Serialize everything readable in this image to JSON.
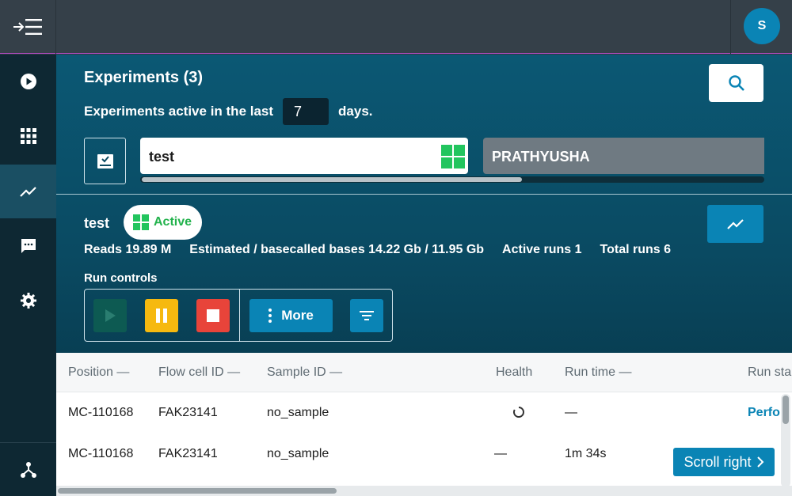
{
  "user": {
    "initial": "S"
  },
  "sidebar": {
    "items": [
      {
        "icon": "play-circle-icon",
        "active": false
      },
      {
        "icon": "apps-grid-icon",
        "active": false
      },
      {
        "icon": "trending-chart-icon",
        "active": true
      },
      {
        "icon": "message-icon",
        "active": false
      },
      {
        "icon": "gear-icon",
        "active": false
      }
    ],
    "bottom_icon": "network-icon"
  },
  "experiments": {
    "title": "Experiments (3)",
    "active_prefix": "Experiments active in the last",
    "days_value": "7",
    "active_suffix": "days.",
    "cards": [
      {
        "name": "test",
        "status_color": "#22c55e"
      },
      {
        "name": "PRATHYUSHA"
      }
    ]
  },
  "selected": {
    "name": "test",
    "status": "Active",
    "stats": {
      "reads": "Reads 19.89 M",
      "bases": "Estimated / basecalled bases 14.22 Gb / 11.95 Gb",
      "active_runs": "Active runs 1",
      "total_runs": "Total runs 6"
    },
    "run_controls_label": "Run controls",
    "more_label": "More"
  },
  "table": {
    "columns": [
      "Position —",
      "Flow cell ID —",
      "Sample ID —",
      "Health",
      "Run time —",
      "Run sta"
    ],
    "rows": [
      {
        "position": "MC-110168",
        "flow_cell": "FAK23141",
        "sample": "no_sample",
        "health": "",
        "run_time": "—",
        "run_state": "Perfo"
      },
      {
        "position": "MC-110168",
        "flow_cell": "FAK23141",
        "sample": "no_sample",
        "health": "—",
        "run_time": "1m 34s",
        "run_state": ""
      }
    ],
    "scroll_right_label": "Scroll right"
  },
  "colors": {
    "accent": "#0a84b5",
    "active_green": "#22c55e",
    "pause": "#f6b90f",
    "stop": "#e8443a"
  }
}
